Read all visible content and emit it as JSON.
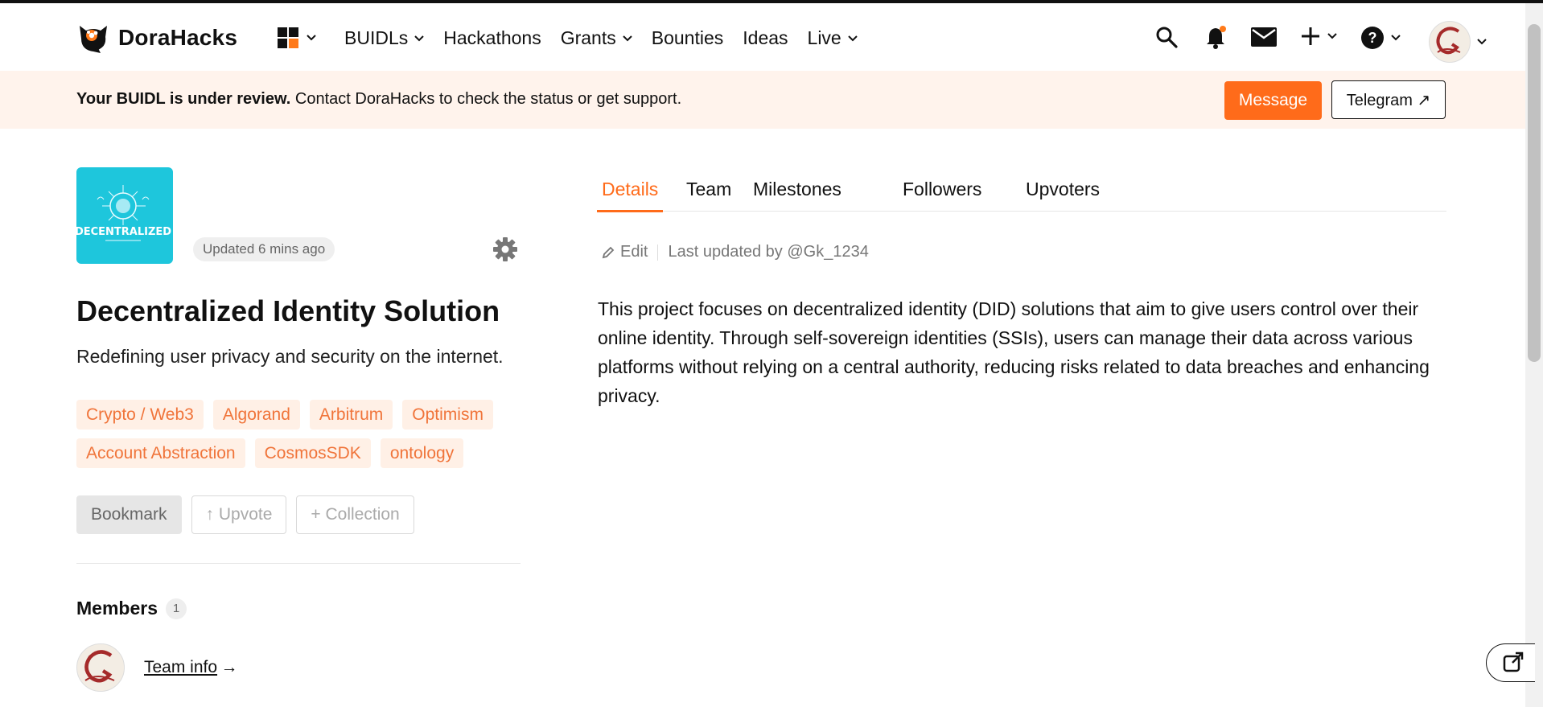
{
  "nav": {
    "brand": "DoraHacks",
    "menu": [
      {
        "label": "BUIDLs",
        "dropdown": true
      },
      {
        "label": "Hackathons",
        "dropdown": false
      },
      {
        "label": "Grants",
        "dropdown": true
      },
      {
        "label": "Bounties",
        "dropdown": false
      },
      {
        "label": "Ideas",
        "dropdown": false
      },
      {
        "label": "Live",
        "dropdown": true
      }
    ],
    "icons": [
      "search-icon",
      "bell-icon",
      "mail-icon",
      "plus-icon",
      "help-icon",
      "avatar"
    ],
    "notification_dot_color": "#ff7a1a"
  },
  "banner": {
    "bold": "Your BUIDL is under review.",
    "text": " Contact DoraHacks to check the status or get support.",
    "message_label": "Message",
    "telegram_label": "Telegram ↗"
  },
  "project": {
    "logo_text": "DECENTRALIZED",
    "updated": "Updated 6 mins ago",
    "title": "Decentralized Identity Solution",
    "subtitle": "Redefining user privacy and security on the internet.",
    "tags_row1": [
      "Crypto / Web3",
      "Algorand",
      "Arbitrum",
      "Optimism"
    ],
    "tags_row2": [
      "Account Abstraction",
      "CosmosSDK",
      "ontology"
    ],
    "bookmark_label": "Bookmark",
    "upvote_label": "↑ Upvote",
    "collection_label": "+ Collection",
    "members_label": "Members",
    "members_count": "1",
    "team_info_label": "Team info",
    "team_info_arrow": "→"
  },
  "tabs": [
    "Details",
    "Team",
    "Milestones",
    "Followers",
    "Upvoters"
  ],
  "active_tab": "Details",
  "details": {
    "edit_label": "Edit",
    "last_updated": "Last updated by @Gk_1234",
    "description": "This project focuses on decentralized identity (DID) solutions that aim to give users control over their online identity. Through self-sovereign identities (SSIs), users can manage their data across various platforms without relying on a central authority, reducing risks related to data breaches and enhancing privacy."
  },
  "colors": {
    "accent": "#ff6b1a",
    "banner_bg": "#fff3ec",
    "tag_bg": "#fff0e6",
    "tag_text": "#f0743a",
    "logo_bg": "#1ec6dc"
  }
}
